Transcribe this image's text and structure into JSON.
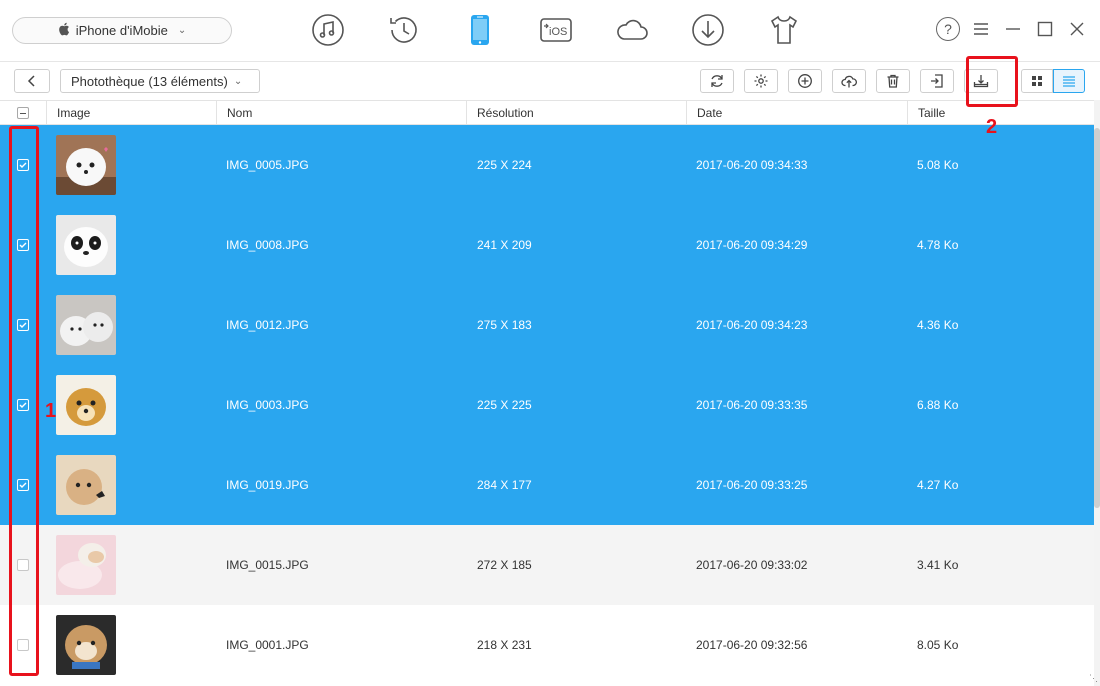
{
  "device": {
    "name": "iPhone d'iMobie"
  },
  "nav": {
    "items": [
      {
        "name": "music-icon",
        "label": ""
      },
      {
        "name": "history-icon",
        "label": ""
      },
      {
        "name": "phone-icon",
        "label": ""
      },
      {
        "name": "to-ios-icon",
        "label": "iOS"
      },
      {
        "name": "icloud-icon",
        "label": ""
      },
      {
        "name": "download-icon",
        "label": ""
      },
      {
        "name": "tshirt-icon",
        "label": ""
      }
    ],
    "active_index": 2
  },
  "window": {
    "help": "?"
  },
  "toolbar": {
    "library_label": "Photothèque (13 éléments)"
  },
  "table": {
    "headers": {
      "image": "Image",
      "nom": "Nom",
      "resolution": "Résolution",
      "date": "Date",
      "taille": "Taille"
    },
    "rows": [
      {
        "name": "IMG_0005.JPG",
        "resolution": "225 X 224",
        "date": "2017-06-20 09:34:33",
        "size": "5.08 Ko",
        "selected": true,
        "thumb": "white-pup"
      },
      {
        "name": "IMG_0008.JPG",
        "resolution": "241 X 209",
        "date": "2017-06-20 09:34:29",
        "size": "4.78 Ko",
        "selected": true,
        "thumb": "panda-pup"
      },
      {
        "name": "IMG_0012.JPG",
        "resolution": "275 X 183",
        "date": "2017-06-20 09:34:23",
        "size": "4.36 Ko",
        "selected": true,
        "thumb": "two-pups"
      },
      {
        "name": "IMG_0003.JPG",
        "resolution": "225 X 225",
        "date": "2017-06-20 09:33:35",
        "size": "6.88 Ko",
        "selected": true,
        "thumb": "golden-pup"
      },
      {
        "name": "IMG_0019.JPG",
        "resolution": "284 X 177",
        "date": "2017-06-20 09:33:25",
        "size": "4.27 Ko",
        "selected": true,
        "thumb": "kitten"
      },
      {
        "name": "IMG_0015.JPG",
        "resolution": "272 X 185",
        "date": "2017-06-20 09:33:02",
        "size": "3.41 Ko",
        "selected": false,
        "thumb": "sleepy-kitten"
      },
      {
        "name": "IMG_0001.JPG",
        "resolution": "218 X 231",
        "date": "2017-06-20 09:32:56",
        "size": "8.05 Ko",
        "selected": false,
        "thumb": "pom-pup"
      }
    ]
  },
  "annotations": {
    "step1": "1",
    "step2": "2"
  },
  "colors": {
    "selection": "#2aa6ef",
    "highlight": "#e8121c",
    "active_nav": "#2aa6ef"
  }
}
